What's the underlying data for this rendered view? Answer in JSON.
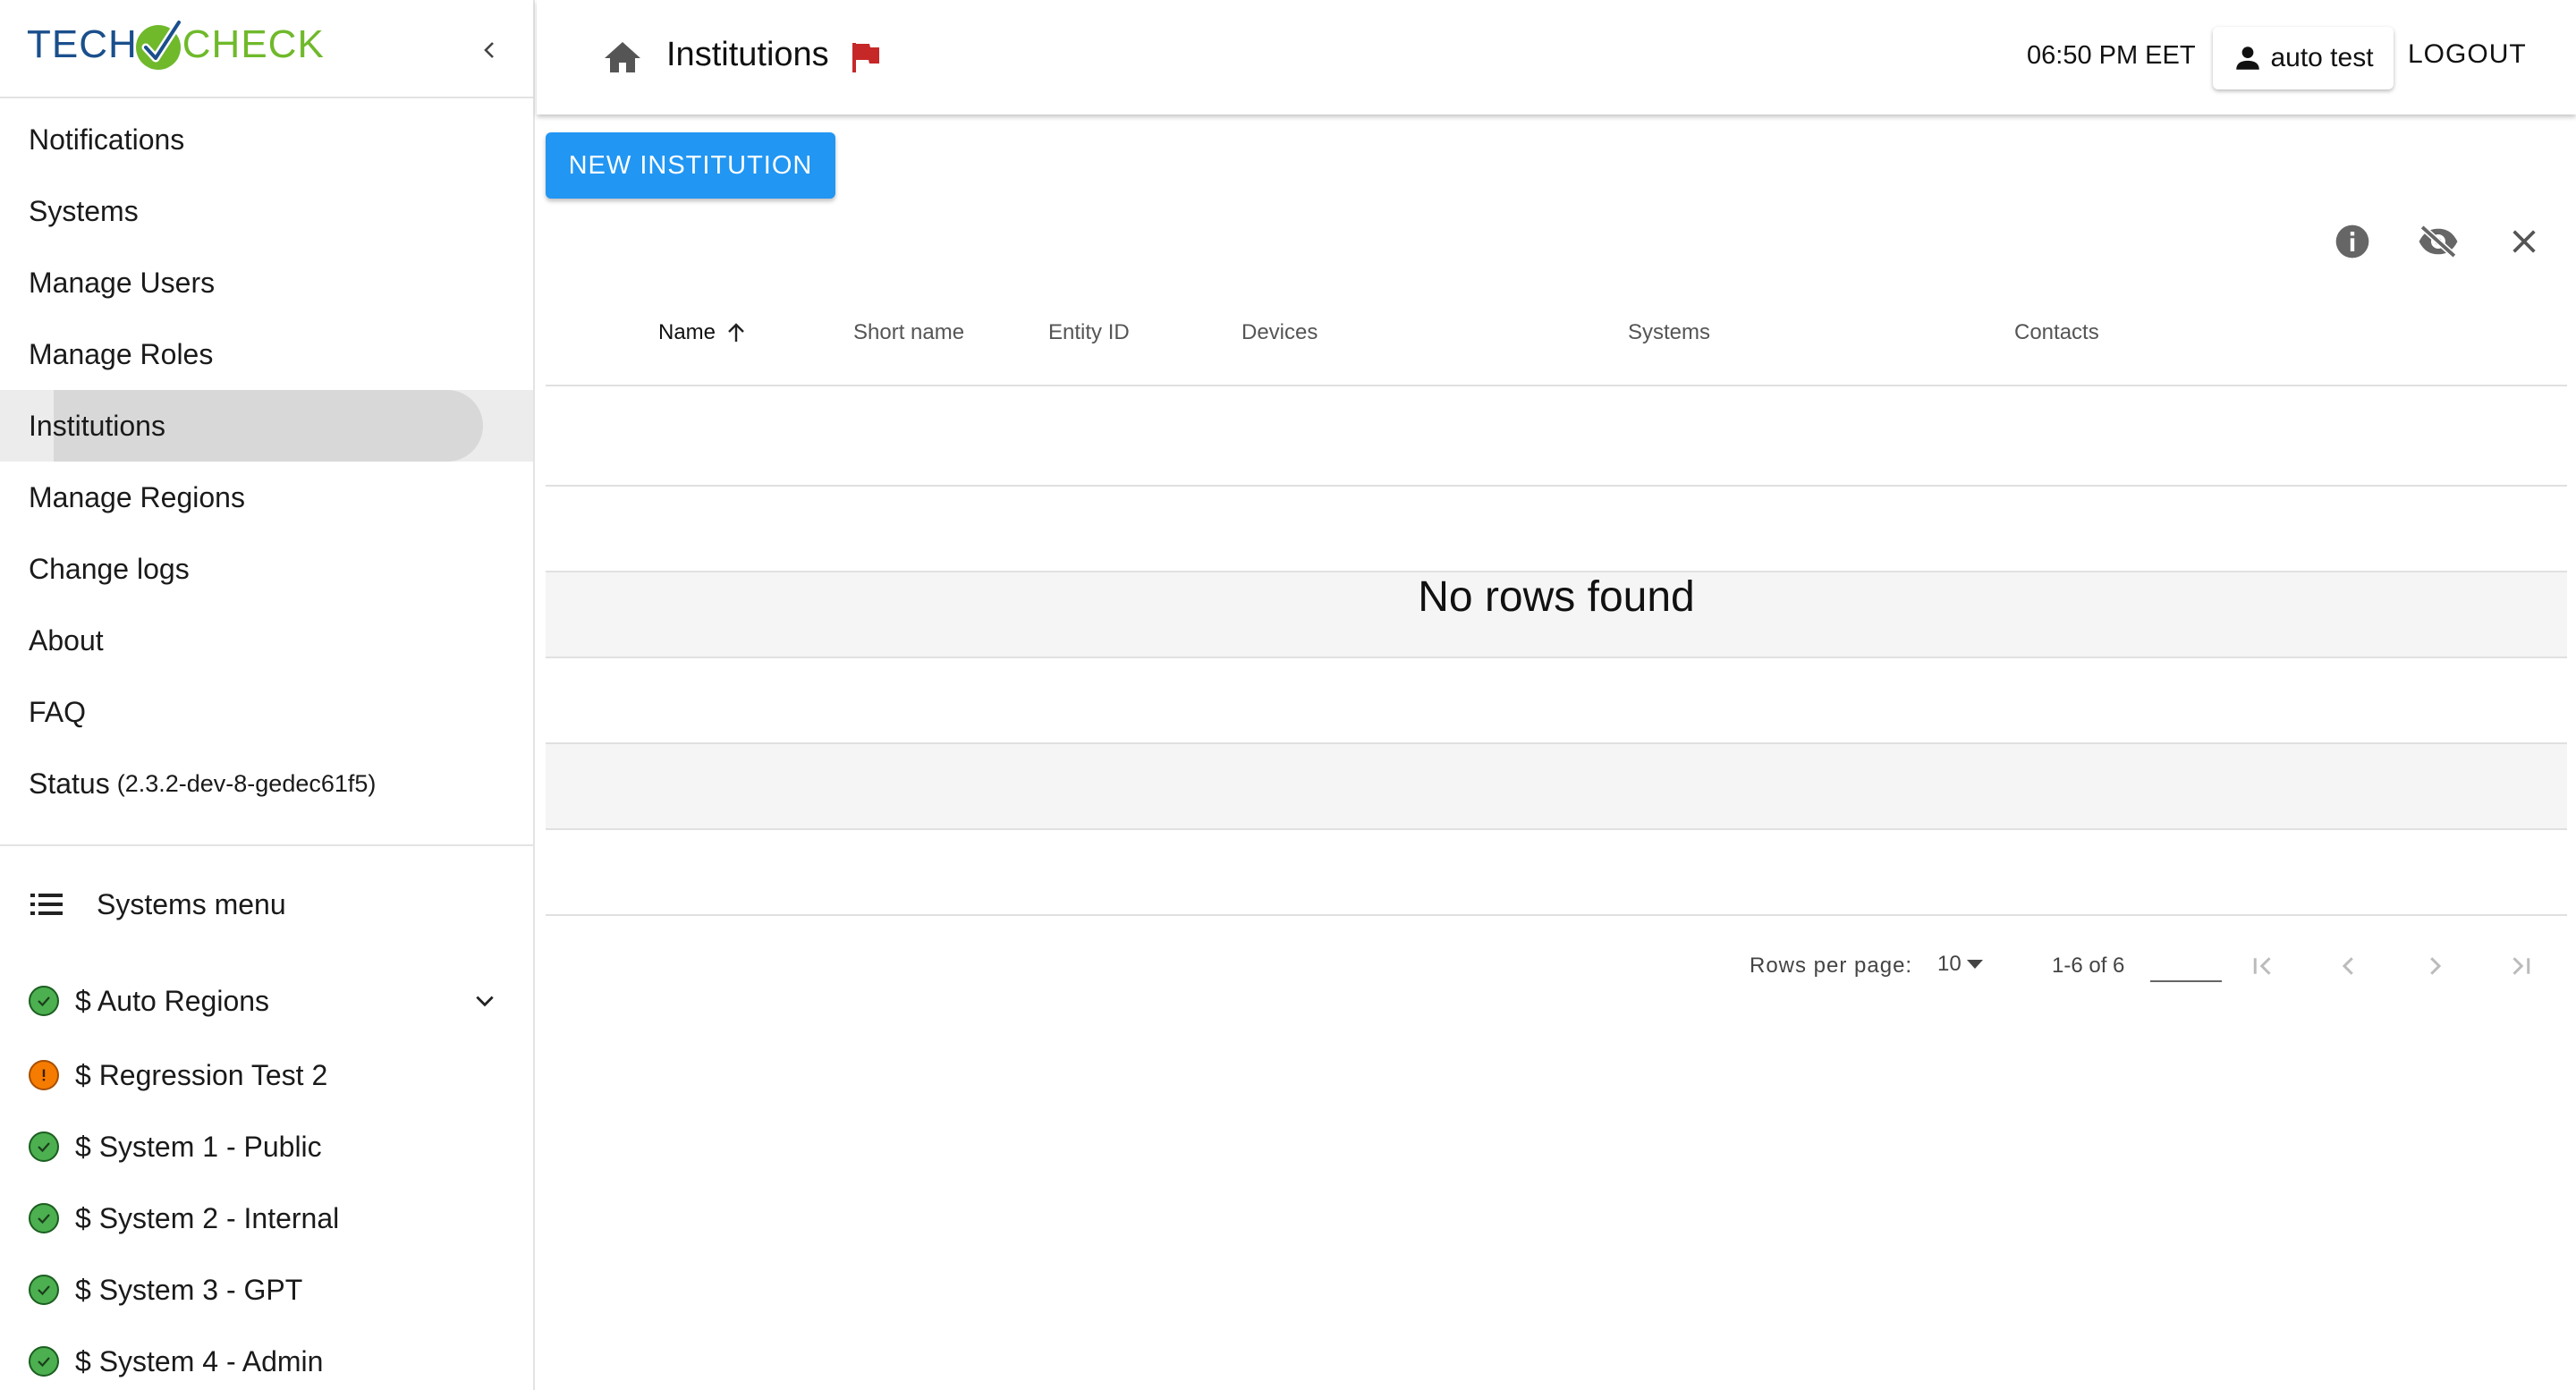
{
  "app": {
    "logo_left": "TECH",
    "logo_right": "CHECK"
  },
  "sidebar": {
    "items": [
      {
        "label": "Notifications"
      },
      {
        "label": "Systems"
      },
      {
        "label": "Manage Users"
      },
      {
        "label": "Manage Roles"
      },
      {
        "label": "Institutions",
        "active": true
      },
      {
        "label": "Manage Regions"
      },
      {
        "label": "Change logs"
      },
      {
        "label": "About"
      },
      {
        "label": "FAQ"
      }
    ],
    "status_label": "Status",
    "status_version": "(2.3.2-dev-8-gedec61f5)",
    "systems_menu_label": "Systems menu",
    "systems": [
      {
        "label": "$ Auto Regions",
        "status": "ok"
      },
      {
        "label": "$ Regression Test 2",
        "status": "warning"
      },
      {
        "label": "$ System 1 - Public",
        "status": "ok"
      },
      {
        "label": "$ System 2 - Internal",
        "status": "ok"
      },
      {
        "label": "$ System 3 - GPT",
        "status": "ok"
      },
      {
        "label": "$ System 4 - Admin",
        "status": "ok"
      }
    ]
  },
  "header": {
    "title": "Institutions",
    "time": "06:50 PM EET",
    "user": "auto test",
    "logout": "LOGOUT"
  },
  "toolbar": {
    "new_button": "NEW INSTITUTION"
  },
  "table": {
    "columns": [
      "Name",
      "Short name",
      "Entity ID",
      "Devices",
      "Systems",
      "Contacts"
    ],
    "sort": {
      "column": "Name",
      "direction": "asc"
    },
    "empty_message": "No rows found"
  },
  "pagination": {
    "rows_per_page_label": "Rows per page:",
    "rows_per_page": "10",
    "range": "1-6 of 6",
    "page_input": ""
  },
  "colors": {
    "primary": "#2196f3",
    "status_ok": "#4caf50",
    "status_warning": "#f57c00",
    "flag": "#c62828"
  }
}
